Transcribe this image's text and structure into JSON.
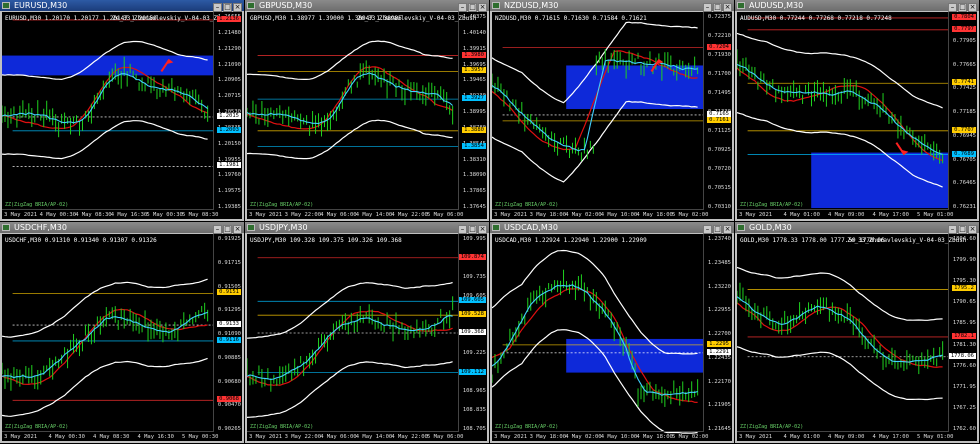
{
  "charts": [
    {
      "title": "EURUSD,M30",
      "info": "EURUSD,M30  1.20170 1.20177 1.20147 1.20159",
      "indicator": "Ze_33_Zhuravlevskiy_V-04-03_Zbush",
      "footer": "ZZ(ZigZag BRIA/AP-02)",
      "active": true,
      "times": [
        "3 May 2021",
        "4 May 00:30",
        "4 May 08:30",
        "4 May 16:30",
        "5 May 00:30",
        "5 May 08:30"
      ],
      "prices": [
        "1.21655",
        "1.21480",
        "1.21290",
        "1.21090",
        "1.20905",
        "1.20715",
        "1.20530",
        "1.20335",
        "1.20150",
        "1.19955",
        "1.19760",
        "1.19575",
        "1.19385"
      ],
      "tags": [
        {
          "text": "1.2136",
          "color": "#ff3333",
          "band": 0.04
        },
        {
          "text": "1.2015",
          "color": "#ffffff",
          "band": 0.53
        },
        {
          "text": "1.2003",
          "color": "#00c0ff",
          "band": 0.6
        },
        {
          "text": "1.1981",
          "color": "#ffffff",
          "band": 0.78
        }
      ],
      "trend": "flat",
      "arrow": "up",
      "zone": {
        "top": 0.22,
        "height": 0.1
      }
    },
    {
      "title": "GBPUSD,M30",
      "info": "GBPUSD,M30  1.38977 1.39000 1.38947 1.38985",
      "indicator": "Ze_33_Zhuravlevskiy_V-04-03_Zbush",
      "footer": "ZZ(ZigZag BRIA/AP-02)",
      "active": false,
      "times": [
        "3 May 2021",
        "3 May 22:00",
        "4 May 06:00",
        "4 May 14:00",
        "4 May 22:00",
        "5 May 06:00"
      ],
      "prices": [
        "1.40375",
        "1.40140",
        "1.39915",
        "1.39695",
        "1.39465",
        "1.39230",
        "1.38995",
        "1.38780",
        "1.38545",
        "1.38310",
        "1.38090",
        "1.37865",
        "1.37645"
      ],
      "tags": [
        {
          "text": "1.3980",
          "color": "#ff3333",
          "band": 0.22
        },
        {
          "text": "1.3957",
          "color": "#ffcc00",
          "band": 0.3
        },
        {
          "text": "1.3927",
          "color": "#00c0ff",
          "band": 0.44
        },
        {
          "text": "1.3880",
          "color": "#ffcc00",
          "band": 0.6
        },
        {
          "text": "1.3854",
          "color": "#00c0ff",
          "band": 0.68
        }
      ],
      "trend": "flat",
      "arrow": "none",
      "zone": null
    },
    {
      "title": "NZDUSD,M30",
      "info": "NZDUSD,M30  0.71615 0.71630 0.71584 0.71621",
      "indicator": "",
      "footer": "ZZ(ZigZag BRIA/AP-02)",
      "active": false,
      "times": [
        "3 May 2021",
        "3 May 18:00",
        "4 May 02:00",
        "4 May 10:00",
        "4 May 18:00",
        "5 May 02:00"
      ],
      "prices": [
        "0.72375",
        "0.72210",
        "0.71930",
        "0.71700",
        "0.71495",
        "0.71330",
        "0.71125",
        "0.70925",
        "0.70720",
        "0.70515",
        "0.70310"
      ],
      "tags": [
        {
          "text": "0.7204",
          "color": "#ff3333",
          "band": 0.18
        },
        {
          "text": "0.7165",
          "color": "#ffffff",
          "band": 0.52
        },
        {
          "text": "0.7161",
          "color": "#ffcc00",
          "band": 0.55
        }
      ],
      "trend": "v",
      "arrow": "up",
      "zone": {
        "top": 0.27,
        "height": 0.22
      }
    },
    {
      "title": "AUDUSD,M30",
      "info": "AUDUSD,M30  0.77244 0.77268 0.77218 0.77248",
      "indicator": "",
      "footer": "ZZ(ZigZag BRIA/AP-02)",
      "active": false,
      "times": [
        "3 May 2021",
        "4 May 01:00",
        "4 May 09:00",
        "4 May 17:00",
        "5 May 01:00"
      ],
      "prices": [
        "0.78140",
        "0.77905",
        "0.77665",
        "0.77425",
        "0.77185",
        "0.76945",
        "0.76705",
        "0.76465",
        "0.76231"
      ],
      "tags": [
        {
          "text": "0.7804",
          "color": "#ff3333",
          "band": 0.03
        },
        {
          "text": "0.7797",
          "color": "#ff3333",
          "band": 0.09
        },
        {
          "text": "0.7741",
          "color": "#ffcc00",
          "band": 0.36
        },
        {
          "text": "0.7707",
          "color": "#ffcc00",
          "band": 0.6
        },
        {
          "text": "0.7689",
          "color": "#00c0ff",
          "band": 0.72
        }
      ],
      "trend": "down",
      "arrow": "down",
      "zone": {
        "top": 0.71,
        "height": 0.28
      }
    },
    {
      "title": "USDCHF,M30",
      "info": "USDCHF,M30  0.91310 0.91340 0.91307 0.91326",
      "indicator": "",
      "footer": "ZZ(ZigZag BRIA/AP-02)",
      "active": false,
      "times": [
        "3 May 2021",
        "4 May 00:30",
        "4 May 08:30",
        "4 May 16:30",
        "5 May 00:30"
      ],
      "prices": [
        "0.91925",
        "0.91715",
        "0.91505",
        "0.91295",
        "0.91090",
        "0.90885",
        "0.90680",
        "0.90470",
        "0.90265"
      ],
      "tags": [
        {
          "text": "0.9151",
          "color": "#ffcc00",
          "band": 0.3
        },
        {
          "text": "0.9133",
          "color": "#ffffff",
          "band": 0.46
        },
        {
          "text": "0.9116",
          "color": "#00c0ff",
          "band": 0.54
        },
        {
          "text": "0.9068",
          "color": "#ff3333",
          "band": 0.84
        }
      ],
      "trend": "up",
      "arrow": "none",
      "zone": null
    },
    {
      "title": "USDJPY,M30",
      "info": "USDJPY,M30  109.328 109.375 109.326 109.368",
      "indicator": "",
      "footer": "ZZ(ZigZag BRIA/AP-02)",
      "active": false,
      "times": [
        "3 May 2021",
        "3 May 22:00",
        "4 May 06:00",
        "4 May 14:00",
        "4 May 22:00",
        "5 May 06:00"
      ],
      "prices": [
        "109.995",
        "109.865",
        "109.735",
        "109.605",
        "109.480",
        "109.350",
        "109.225",
        "109.095",
        "108.965",
        "108.835",
        "108.705"
      ],
      "tags": [
        {
          "text": "109.874",
          "color": "#ff3333",
          "band": 0.12
        },
        {
          "text": "109.605",
          "color": "#00c0ff",
          "band": 0.34
        },
        {
          "text": "109.528",
          "color": "#ffcc00",
          "band": 0.41
        },
        {
          "text": "109.368",
          "color": "#ffffff",
          "band": 0.5
        },
        {
          "text": "109.112",
          "color": "#00c0ff",
          "band": 0.7
        }
      ],
      "trend": "up",
      "arrow": "none",
      "zone": null
    },
    {
      "title": "USDCAD,M30",
      "info": "USDCAD,M30  1.22924 1.22940 1.22900 1.22909",
      "indicator": "",
      "footer": "ZZ(ZigZag BRIA/AP-02)",
      "active": false,
      "times": [
        "3 May 2021",
        "3 May 18:00",
        "4 May 02:00",
        "4 May 10:00",
        "4 May 18:00",
        "5 May 02:00"
      ],
      "prices": [
        "1.23740",
        "1.23485",
        "1.23220",
        "1.22955",
        "1.22700",
        "1.22435",
        "1.22170",
        "1.21905",
        "1.21645"
      ],
      "tags": [
        {
          "text": "1.2295",
          "color": "#ffcc00",
          "band": 0.56
        },
        {
          "text": "1.2291",
          "color": "#ffffff",
          "band": 0.6
        }
      ],
      "trend": "hump",
      "arrow": "none",
      "zone": {
        "top": 0.53,
        "height": 0.17
      }
    },
    {
      "title": "GOLD,M30",
      "info": "GOLD,M30  1778.33 1778.00 1777.59 1778.06",
      "indicator": "Ze_33_Zhuravlevskiy_V-04-03_Zbush",
      "footer": "ZZ(ZigZag BRIA/AP-02)",
      "active": false,
      "times": [
        "3 May 2021",
        "4 May 01:00",
        "4 May 09:00",
        "4 May 17:00",
        "5 May 01:00"
      ],
      "prices": [
        "1804.60",
        "1799.90",
        "1795.30",
        "1790.65",
        "1785.95",
        "1781.30",
        "1776.60",
        "1771.95",
        "1767.25",
        "1762.60"
      ],
      "tags": [
        {
          "text": "1795.2",
          "color": "#ffcc00",
          "band": 0.28
        },
        {
          "text": "1782.1",
          "color": "#ff3333",
          "band": 0.52
        },
        {
          "text": "1778.06",
          "color": "#ffffff",
          "band": 0.62
        }
      ],
      "trend": "drop",
      "arrow": "none",
      "zone": null
    }
  ]
}
